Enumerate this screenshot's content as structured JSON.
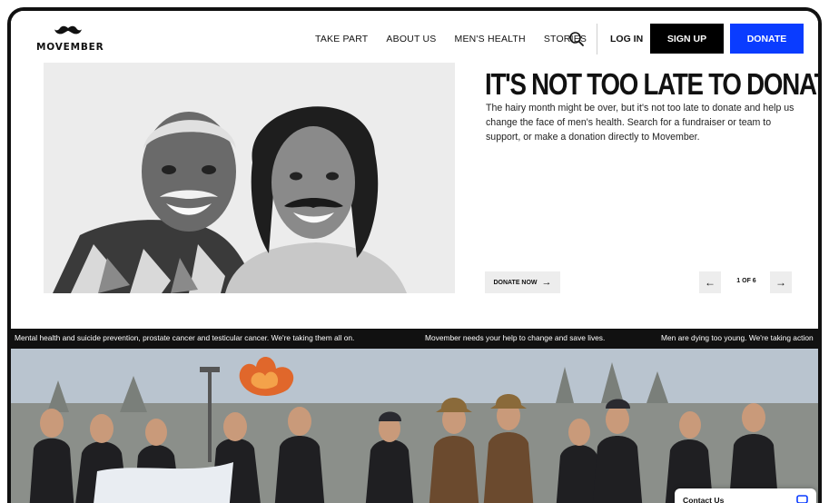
{
  "brand": {
    "name": "MOVEMBER"
  },
  "nav": {
    "items": [
      "TAKE PART",
      "ABOUT US",
      "MEN'S HEALTH",
      "STORIES"
    ],
    "login": "LOG IN",
    "signup": "SIGN UP",
    "donate": "DONATE"
  },
  "hero": {
    "title": "IT'S NOT TOO LATE TO DONATE",
    "text": "The hairy month might be over, but it's not too late to donate and help us change the face of men's health. Search for a fundraiser or team to support, or make a donation directly to Movember.",
    "cta": "DONATE NOW",
    "pager": {
      "count": "1 OF 6"
    }
  },
  "ticker": [
    "Mental health and suicide prevention, prostate cancer and testicular cancer. We're taking them all on.",
    "Movember needs your help to change and save lives.",
    "Men are dying too young. We're taking action"
  ],
  "contact": {
    "label": "Contact Us"
  },
  "colors": {
    "accent": "#0a3cff",
    "black": "#000000"
  },
  "icons": {
    "search": "search-icon",
    "arrow": "arrow-right-icon",
    "chat": "chat-icon"
  }
}
